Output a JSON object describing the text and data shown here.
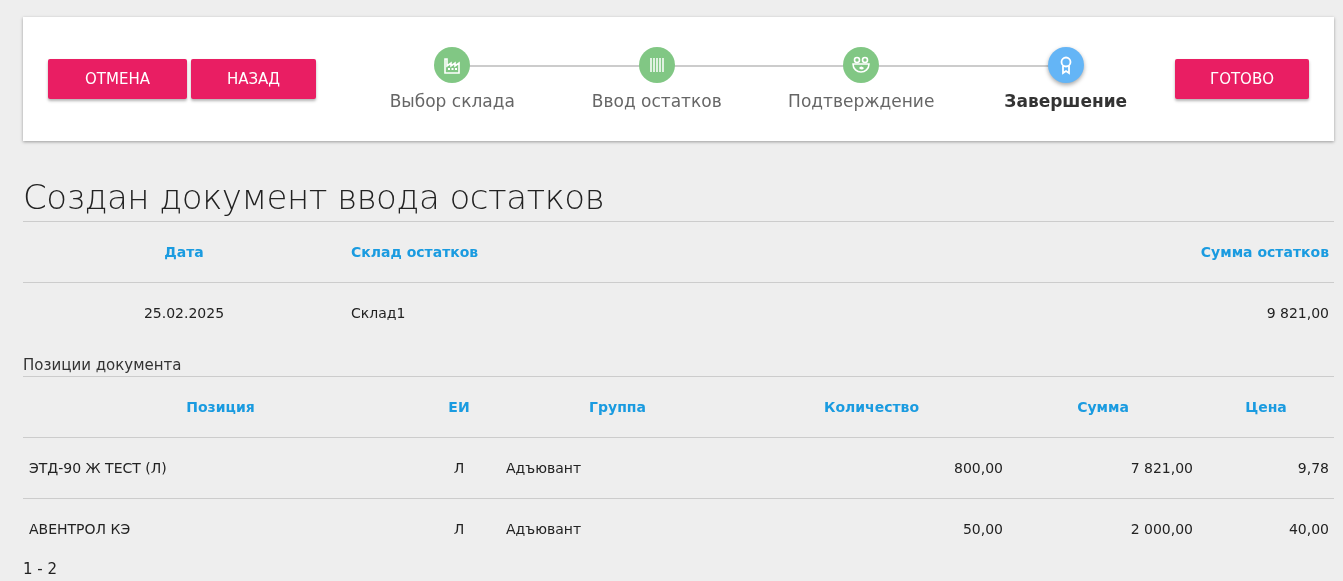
{
  "toolbar": {
    "buttons_left": [
      "ОТМЕНА",
      "НАЗАД"
    ],
    "button_right": "ГОТОВО"
  },
  "steps": [
    {
      "label": "Выбор склада",
      "selected": false
    },
    {
      "label": "Ввод остатков",
      "selected": false
    },
    {
      "label": "Подтверждение",
      "selected": false
    },
    {
      "label": "Завершение",
      "selected": true
    }
  ],
  "title": "Создан документ ввода остатков",
  "summary": {
    "columns": [
      "Дата",
      "Склад остатков",
      "Сумма остатков"
    ],
    "row": [
      "25.02.2025",
      "Склад1",
      "9 821,00"
    ]
  },
  "positions_caption": "Позиции документа",
  "positions": {
    "columns": [
      "Позиция",
      "ЕИ",
      "Группа",
      "Количество",
      "Сумма",
      "Цена"
    ],
    "rows": [
      [
        "ЭТД-90 Ж ТЕСТ (Л)",
        "Л",
        "Адъювант",
        "800,00",
        "7 821,00",
        "9,78"
      ],
      [
        "АВЕНТРОЛ КЭ",
        "Л",
        "Адъювант",
        "50,00",
        "2 000,00",
        "40,00"
      ]
    ]
  },
  "pager": "1 - 2"
}
